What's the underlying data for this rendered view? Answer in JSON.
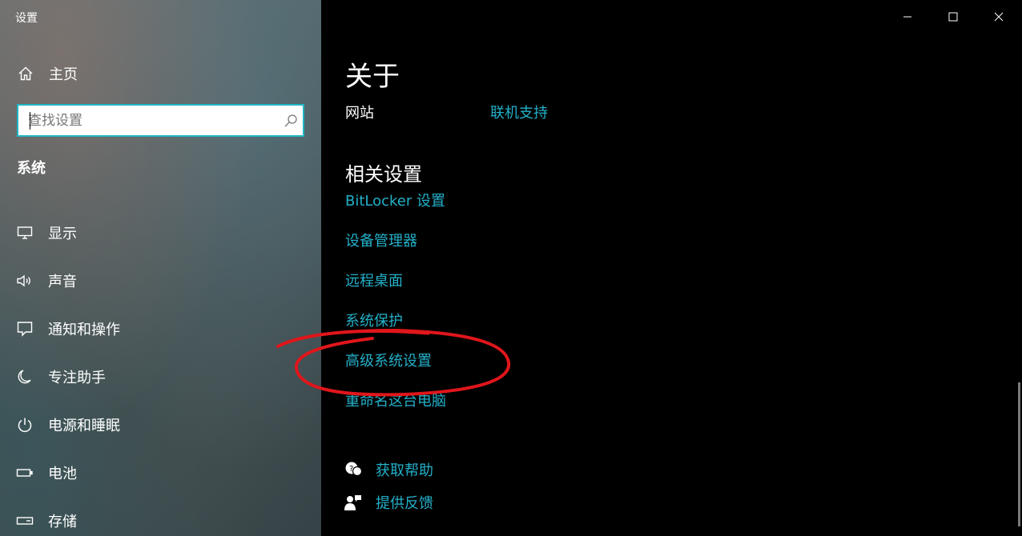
{
  "app": {
    "title": "设置"
  },
  "sidebar": {
    "home_label": "主页",
    "search": {
      "placeholder": "查找设置"
    },
    "section_heading": "系统",
    "items": [
      {
        "label": "显示",
        "icon": "display-icon"
      },
      {
        "label": "声音",
        "icon": "speaker-icon"
      },
      {
        "label": "通知和操作",
        "icon": "notification-icon"
      },
      {
        "label": "专注助手",
        "icon": "moon-icon"
      },
      {
        "label": "电源和睡眠",
        "icon": "power-icon"
      },
      {
        "label": "电池",
        "icon": "battery-icon"
      },
      {
        "label": "存储",
        "icon": "storage-icon"
      }
    ]
  },
  "main": {
    "title": "关于",
    "website_label": "网站",
    "website_link": "联机支持",
    "related_title": "相关设置",
    "related_links": [
      "BitLocker 设置",
      "设备管理器",
      "远程桌面",
      "系统保护",
      "高级系统设置",
      "重命名这台电脑"
    ],
    "help": {
      "get_help": "获取帮助",
      "feedback": "提供反馈"
    }
  },
  "colors": {
    "accent": "#23b0c9",
    "search_border": "#1fb7c4",
    "annotation": "#e0161b"
  }
}
